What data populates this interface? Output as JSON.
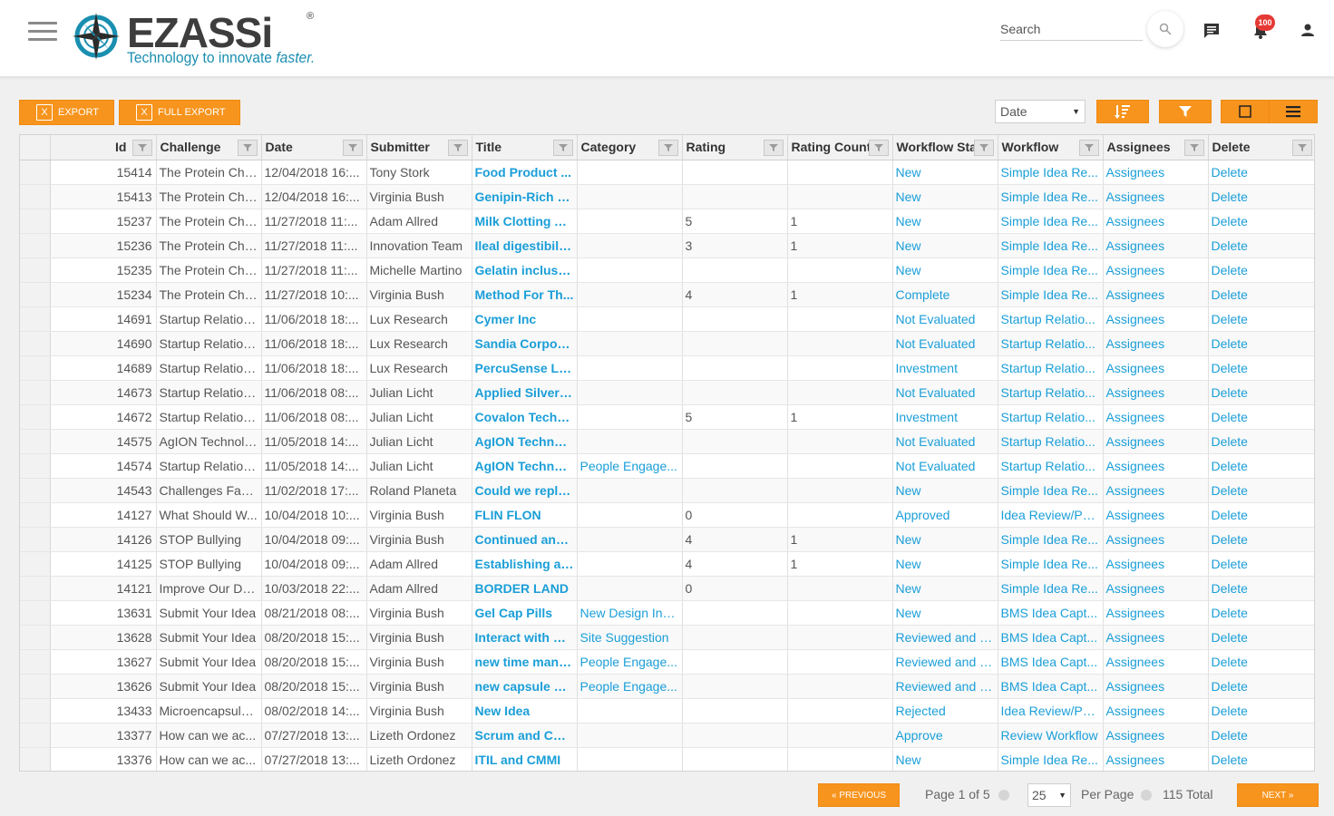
{
  "header": {
    "logo_text": "EZASSi",
    "logo_reg": "®",
    "tagline_main": "Technology to innovate ",
    "tagline_em": "faster.",
    "search_placeholder": "Search",
    "notification_count": "100"
  },
  "toolbar": {
    "export_label": "Export",
    "full_export_label": "Full Export",
    "sort_by_value": "Date"
  },
  "grid": {
    "columns": [
      "Id",
      "Challenge",
      "Date",
      "Submitter",
      "Title",
      "Category",
      "Rating",
      "Rating Count",
      "Workflow Stage",
      "Workflow",
      "Assignees",
      "Delete"
    ],
    "rows": [
      {
        "id": "15414",
        "challenge": "The Protein Cha...",
        "date": "12/04/2018 16:...",
        "submitter": "Tony Stork",
        "title": "Food Product ...",
        "category": "",
        "rating": "",
        "rating_count": "",
        "stage": "New",
        "workflow": "Simple Idea Re...",
        "assignees": "Assignees",
        "delete": "Delete"
      },
      {
        "id": "15413",
        "challenge": "The Protein Cha...",
        "date": "12/04/2018 16:...",
        "submitter": "Virginia Bush",
        "title": "Genipin-Rich M...",
        "category": "",
        "rating": "",
        "rating_count": "",
        "stage": "New",
        "workflow": "Simple Idea Re...",
        "assignees": "Assignees",
        "delete": "Delete"
      },
      {
        "id": "15237",
        "challenge": "The Protein Cha...",
        "date": "11/27/2018 11:...",
        "submitter": "Adam Allred",
        "title": "Milk Clotting A...",
        "category": "",
        "rating": "5",
        "rating_count": "1",
        "stage": "New",
        "workflow": "Simple Idea Re...",
        "assignees": "Assignees",
        "delete": "Delete"
      },
      {
        "id": "15236",
        "challenge": "The Protein Cha...",
        "date": "11/27/2018 11:...",
        "submitter": "Innovation Team",
        "title": "Ileal digestibilit...",
        "category": "",
        "rating": "3",
        "rating_count": "1",
        "stage": "New",
        "workflow": "Simple Idea Re...",
        "assignees": "Assignees",
        "delete": "Delete"
      },
      {
        "id": "15235",
        "challenge": "The Protein Cha...",
        "date": "11/27/2018 11:...",
        "submitter": "Michelle Martino",
        "title": "Gelatin inclusio...",
        "category": "",
        "rating": "",
        "rating_count": "",
        "stage": "New",
        "workflow": "Simple Idea Re...",
        "assignees": "Assignees",
        "delete": "Delete"
      },
      {
        "id": "15234",
        "challenge": "The Protein Cha...",
        "date": "11/27/2018 10:...",
        "submitter": "Virginia Bush",
        "title": "Method For Th...",
        "category": "",
        "rating": "4",
        "rating_count": "1",
        "stage": "Complete",
        "workflow": "Simple Idea Re...",
        "assignees": "Assignees",
        "delete": "Delete"
      },
      {
        "id": "14691",
        "challenge": "Startup Relation...",
        "date": "11/06/2018 18:...",
        "submitter": "Lux Research",
        "title": "Cymer Inc",
        "category": "",
        "rating": "",
        "rating_count": "",
        "stage": "Not Evaluated",
        "workflow": "Startup Relatio...",
        "assignees": "Assignees",
        "delete": "Delete"
      },
      {
        "id": "14690",
        "challenge": "Startup Relation...",
        "date": "11/06/2018 18:...",
        "submitter": "Lux Research",
        "title": "Sandia Corpora...",
        "category": "",
        "rating": "",
        "rating_count": "",
        "stage": "Not Evaluated",
        "workflow": "Startup Relatio...",
        "assignees": "Assignees",
        "delete": "Delete"
      },
      {
        "id": "14689",
        "challenge": "Startup Relation...",
        "date": "11/06/2018 18:...",
        "submitter": "Lux Research",
        "title": "PercuSense LLC",
        "category": "",
        "rating": "",
        "rating_count": "",
        "stage": "Investment",
        "workflow": "Startup Relatio...",
        "assignees": "Assignees",
        "delete": "Delete"
      },
      {
        "id": "14673",
        "challenge": "Startup Relation...",
        "date": "11/06/2018 08:...",
        "submitter": "Julian Licht",
        "title": "Applied Silver I...",
        "category": "",
        "rating": "",
        "rating_count": "",
        "stage": "Not Evaluated",
        "workflow": "Startup Relatio...",
        "assignees": "Assignees",
        "delete": "Delete"
      },
      {
        "id": "14672",
        "challenge": "Startup Relation...",
        "date": "11/06/2018 08:...",
        "submitter": "Julian Licht",
        "title": "Covalon Techn...",
        "category": "",
        "rating": "5",
        "rating_count": "1",
        "stage": "Investment",
        "workflow": "Startup Relatio...",
        "assignees": "Assignees",
        "delete": "Delete"
      },
      {
        "id": "14575",
        "challenge": "AgION Technolo...",
        "date": "11/05/2018 14:...",
        "submitter": "Julian Licht",
        "title": "AgION Technol...",
        "category": "",
        "rating": "",
        "rating_count": "",
        "stage": "Not Evaluated",
        "workflow": "Startup Relatio...",
        "assignees": "Assignees",
        "delete": "Delete"
      },
      {
        "id": "14574",
        "challenge": "Startup Relation...",
        "date": "11/05/2018 14:...",
        "submitter": "Julian Licht",
        "title": "AgION Technol...",
        "category": "People Engage...",
        "rating": "",
        "rating_count": "",
        "stage": "Not Evaluated",
        "workflow": "Startup Relatio...",
        "assignees": "Assignees",
        "delete": "Delete"
      },
      {
        "id": "14543",
        "challenge": "Challenges Faci...",
        "date": "11/02/2018 17:...",
        "submitter": "Roland Planeta",
        "title": "Could we repla...",
        "category": "",
        "rating": "",
        "rating_count": "",
        "stage": "New",
        "workflow": "Simple Idea Re...",
        "assignees": "Assignees",
        "delete": "Delete"
      },
      {
        "id": "14127",
        "challenge": "What Should W...",
        "date": "10/04/2018 10:...",
        "submitter": "Virginia Bush",
        "title": "FLIN FLON",
        "category": "",
        "rating": "0",
        "rating_count": "",
        "stage": "Approved",
        "workflow": "Idea Review/PL...",
        "assignees": "Assignees",
        "delete": "Delete"
      },
      {
        "id": "14126",
        "challenge": "STOP Bullying",
        "date": "10/04/2018 09:...",
        "submitter": "Virginia Bush",
        "title": "Continued and ...",
        "category": "",
        "rating": "4",
        "rating_count": "1",
        "stage": "New",
        "workflow": "Simple Idea Re...",
        "assignees": "Assignees",
        "delete": "Delete"
      },
      {
        "id": "14125",
        "challenge": "STOP Bullying",
        "date": "10/04/2018 09:...",
        "submitter": "Adam Allred",
        "title": "Establishing an...",
        "category": "",
        "rating": "4",
        "rating_count": "1",
        "stage": "New",
        "workflow": "Simple Idea Re...",
        "assignees": "Assignees",
        "delete": "Delete"
      },
      {
        "id": "14121",
        "challenge": "Improve Our Dat...",
        "date": "10/03/2018 22:...",
        "submitter": "Adam Allred",
        "title": "BORDER LAND",
        "category": "",
        "rating": "0",
        "rating_count": "",
        "stage": "New",
        "workflow": "Simple Idea Re...",
        "assignees": "Assignees",
        "delete": "Delete"
      },
      {
        "id": "13631",
        "challenge": "Submit Your Idea",
        "date": "08/21/2018 08:...",
        "submitter": "Virginia Bush",
        "title": "Gel Cap Pills",
        "category": "New Design Inn...",
        "rating": "",
        "rating_count": "",
        "stage": "New",
        "workflow": "BMS Idea Capt...",
        "assignees": "Assignees",
        "delete": "Delete"
      },
      {
        "id": "13628",
        "challenge": "Submit Your Idea",
        "date": "08/20/2018 15:...",
        "submitter": "Virginia Bush",
        "title": "Interact with Ne...",
        "category": "Site Suggestion",
        "rating": "",
        "rating_count": "",
        "stage": "Reviewed and F...",
        "workflow": "BMS Idea Capt...",
        "assignees": "Assignees",
        "delete": "Delete"
      },
      {
        "id": "13627",
        "challenge": "Submit Your Idea",
        "date": "08/20/2018 15:...",
        "submitter": "Virginia Bush",
        "title": "new time mana...",
        "category": "People Engage...",
        "rating": "",
        "rating_count": "",
        "stage": "Reviewed and F...",
        "workflow": "BMS Idea Capt...",
        "assignees": "Assignees",
        "delete": "Delete"
      },
      {
        "id": "13626",
        "challenge": "Submit Your Idea",
        "date": "08/20/2018 15:...",
        "submitter": "Virginia Bush",
        "title": "new capsule de...",
        "category": "People Engage...",
        "rating": "",
        "rating_count": "",
        "stage": "Reviewed and F...",
        "workflow": "BMS Idea Capt...",
        "assignees": "Assignees",
        "delete": "Delete"
      },
      {
        "id": "13433",
        "challenge": "Microencapsula...",
        "date": "08/02/2018 14:...",
        "submitter": "Virginia Bush",
        "title": "New Idea",
        "category": "",
        "rating": "",
        "rating_count": "",
        "stage": "Rejected",
        "workflow": "Idea Review/PL...",
        "assignees": "Assignees",
        "delete": "Delete"
      },
      {
        "id": "13377",
        "challenge": "How can we ac...",
        "date": "07/27/2018 13:...",
        "submitter": "Lizeth Ordonez",
        "title": "Scrum and CMMI",
        "category": "",
        "rating": "",
        "rating_count": "",
        "stage": "Approve",
        "workflow": "Review Workflow",
        "assignees": "Assignees",
        "delete": "Delete"
      },
      {
        "id": "13376",
        "challenge": "How can we ac...",
        "date": "07/27/2018 13:...",
        "submitter": "Lizeth Ordonez",
        "title": "ITIL and CMMI",
        "category": "",
        "rating": "",
        "rating_count": "",
        "stage": "New",
        "workflow": "Simple Idea Re...",
        "assignees": "Assignees",
        "delete": "Delete"
      }
    ]
  },
  "pagination": {
    "previous_label": "« Previous",
    "page_info": "Page 1 of 5",
    "per_page_value": "25",
    "per_page_label": "Per Page",
    "total_label": "115 Total",
    "next_label": "Next »"
  },
  "colors": {
    "accent_orange": "#f7941d",
    "link_blue": "#1a9ed8",
    "badge_red": "#e53935",
    "logo_teal": "#1a8fb0"
  },
  "icons": [
    "hamburger-menu-icon",
    "compass-logo-icon",
    "search-icon",
    "chat-icon",
    "bell-icon",
    "user-icon",
    "excel-icon",
    "sort-icon",
    "filter-icon",
    "card-view-icon",
    "list-view-icon",
    "column-filter-icon"
  ]
}
